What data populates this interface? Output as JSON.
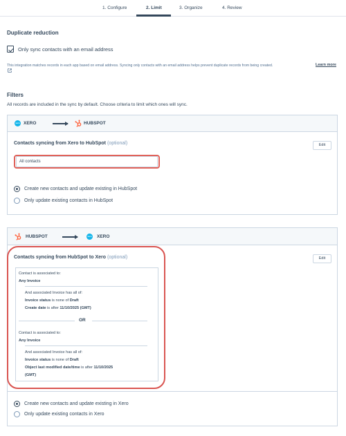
{
  "stepper": {
    "steps": [
      {
        "label": "1. Configure"
      },
      {
        "label": "2. Limit"
      },
      {
        "label": "3. Organize"
      },
      {
        "label": "4. Review"
      }
    ]
  },
  "duplicate": {
    "title": "Duplicate reduction",
    "checkbox_label": "Only sync contacts with an email address",
    "checked": true,
    "help_text": "This integration matches records in each app based on email address. Syncing only contacts with an email address helps prevent duplicate records from being created.",
    "learn_more": "Learn more"
  },
  "filters": {
    "title": "Filters",
    "description": "All records are included in the sync by default. Choose criteria to limit which ones will sync."
  },
  "card1": {
    "source_app": "XERO",
    "target_app": "HUBSPOT",
    "title": "Contacts syncing from Xero to HubSpot",
    "optional": "(optional)",
    "edit_label": "Edit",
    "filter_value": "All contacts",
    "radio_options": [
      {
        "label": "Create new contacts and update existing in HubSpot",
        "selected": true
      },
      {
        "label": "Only update existing contacts in HubSpot",
        "selected": false
      }
    ]
  },
  "card2": {
    "source_app": "HUBSPOT",
    "target_app": "XERO",
    "title": "Contacts syncing from HubSpot to Xero",
    "optional": "(optional)",
    "edit_label": "Edit",
    "group1": {
      "assoc_label": "Contact is associated to:",
      "assoc_value": "Any Invoice",
      "has_all": "And associated Invoice has all of:",
      "cond1_prop": "Invoice status",
      "cond1_op": " is none of ",
      "cond1_val": "Draft",
      "cond2_prop": "Create date",
      "cond2_op": " is after ",
      "cond2_val": "11/10/2025 (GMT)"
    },
    "or_label": "OR",
    "group2": {
      "assoc_label": "Contact is associated to:",
      "assoc_value": "Any Invoice",
      "has_all": "And associated Invoice has all of:",
      "cond1_prop": "Invoice status",
      "cond1_op": " is none of ",
      "cond1_val": "Draft",
      "cond2_prop": "Object last modified date/time",
      "cond2_op": " is after ",
      "cond2_val": "11/10/2025",
      "cond2_val_cont": "(GMT)"
    },
    "radio_options": [
      {
        "label": "Create new contacts and update existing in Xero",
        "selected": true
      },
      {
        "label": "Only update existing contacts in Xero",
        "selected": false
      }
    ]
  },
  "colors": {
    "text": "#33475b",
    "border": "#cbd6e2",
    "xero": "#13b5ea",
    "hubspot": "#ff5c35",
    "highlight": "#d9534f"
  },
  "icons": {
    "xero": "xero-logo-icon",
    "hubspot": "hubspot-logo-icon",
    "external": "external-link-icon"
  }
}
